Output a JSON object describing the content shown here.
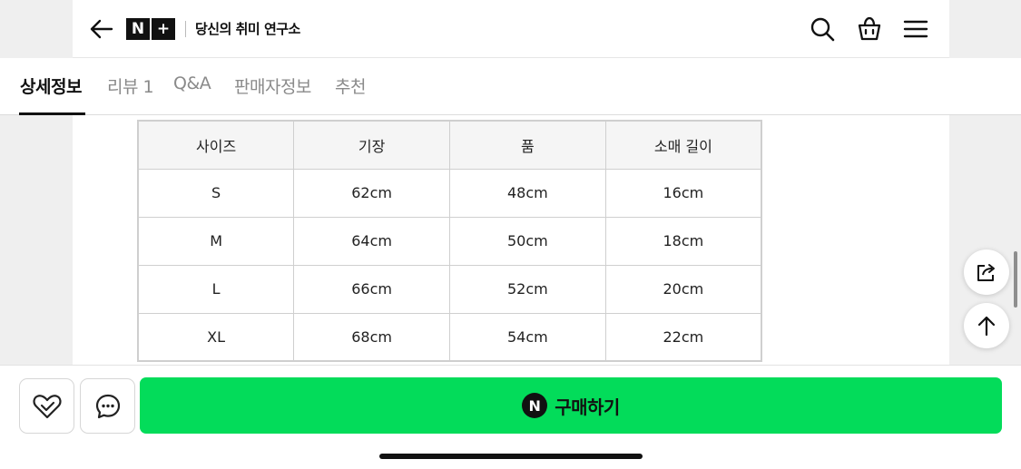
{
  "header": {
    "logo_mark": [
      "N",
      "+"
    ],
    "logo_text": "당신의 취미 연구소",
    "icons": [
      "back-arrow-icon",
      "search-icon",
      "shopping-bag-icon",
      "menu-icon"
    ]
  },
  "tabs": [
    {
      "label": "상세정보",
      "active": true
    },
    {
      "label": "리뷰 1",
      "active": false
    },
    {
      "label": "Q&A",
      "active": false
    },
    {
      "label": "판매자정보",
      "active": false
    },
    {
      "label": "추천",
      "active": false
    }
  ],
  "size_table": {
    "headers": [
      "사이즈",
      "기장",
      "품",
      "소매 길이"
    ],
    "rows": [
      [
        "S",
        "62cm",
        "48cm",
        "16cm"
      ],
      [
        "M",
        "64cm",
        "50cm",
        "18cm"
      ],
      [
        "L",
        "66cm",
        "52cm",
        "20cm"
      ],
      [
        "XL",
        "68cm",
        "54cm",
        "22cm"
      ]
    ]
  },
  "floating": {
    "icons": [
      "share-icon",
      "arrow-up-icon"
    ]
  },
  "bottom_bar": {
    "npay_badge": "N",
    "buy_label": "구매하기",
    "buy_color": "#03dc5a"
  }
}
